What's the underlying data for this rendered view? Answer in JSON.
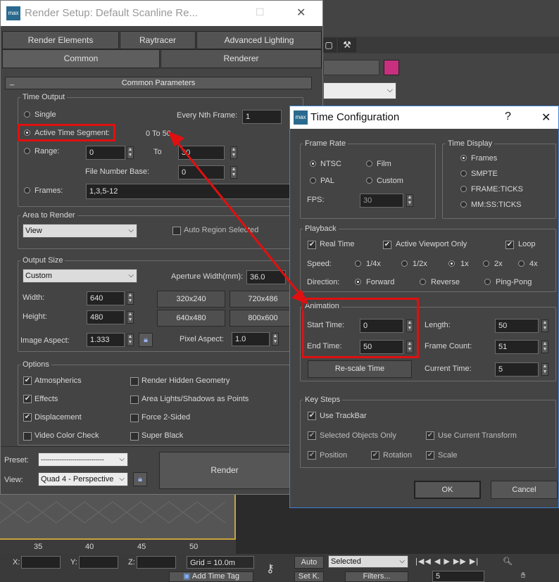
{
  "render_setup": {
    "title": "Render Setup: Default Scanline Re...",
    "tabs_row1": [
      "Render Elements",
      "Raytracer",
      "Advanced Lighting"
    ],
    "tabs_row2": [
      "Common",
      "Renderer"
    ],
    "rollout_title": "Common Parameters",
    "rollout_toggle": "_",
    "time_output": {
      "label": "Time Output",
      "single": "Single",
      "every_nth_label": "Every Nth Frame:",
      "every_nth_value": "1",
      "active_segment": "Active Time Segment:",
      "active_segment_value": "0 To 50",
      "range": "Range:",
      "range_from": "0",
      "range_to_label": "To",
      "range_to": "30",
      "file_number_base_label": "File Number Base:",
      "file_number_base": "0",
      "frames": "Frames:",
      "frames_value": "1,3,5-12"
    },
    "area_to_render": {
      "label": "Area to Render",
      "selected": "View",
      "auto_region": "Auto Region Selected"
    },
    "output_size": {
      "label": "Output Size",
      "preset": "Custom",
      "aperture_label": "Aperture Width(mm):",
      "aperture_value": "36.0",
      "width_label": "Width:",
      "width": "640",
      "height_label": "Height:",
      "height": "480",
      "presets": [
        "320x240",
        "720x486",
        "640x480",
        "800x600"
      ],
      "image_aspect_label": "Image Aspect:",
      "image_aspect": "1.333",
      "pixel_aspect_label": "Pixel Aspect:",
      "pixel_aspect": "1.0"
    },
    "options": {
      "label": "Options",
      "items": [
        {
          "label": "Atmospherics",
          "checked": true
        },
        {
          "label": "Render Hidden Geometry",
          "checked": false
        },
        {
          "label": "Effects",
          "checked": true
        },
        {
          "label": "Area Lights/Shadows as Points",
          "checked": false
        },
        {
          "label": "Displacement",
          "checked": true
        },
        {
          "label": "Force 2-Sided",
          "checked": false
        },
        {
          "label": "Video Color Check",
          "checked": false
        },
        {
          "label": "Super Black",
          "checked": false
        }
      ]
    },
    "preset_label": "Preset:",
    "preset_value": "------------------------------",
    "view_label": "View:",
    "view_value": "Quad 4 - Perspective",
    "render_button": "Render"
  },
  "time_configuration": {
    "title": "Time Configuration",
    "help": "?",
    "close": "✕",
    "frame_rate": {
      "label": "Frame Rate",
      "options": [
        "NTSC",
        "Film",
        "PAL",
        "Custom"
      ],
      "selected": "NTSC",
      "fps_label": "FPS:",
      "fps": "30"
    },
    "time_display": {
      "label": "Time Display",
      "options": [
        "Frames",
        "SMPTE",
        "FRAME:TICKS",
        "MM:SS:TICKS"
      ],
      "selected": "Frames"
    },
    "playback": {
      "label": "Playback",
      "real_time": "Real Time",
      "active_viewport_only": "Active Viewport Only",
      "loop": "Loop",
      "speed_label": "Speed:",
      "speeds": [
        "1/4x",
        "1/2x",
        "1x",
        "2x",
        "4x"
      ],
      "speed_selected": "1x",
      "direction_label": "Direction:",
      "directions": [
        "Forward",
        "Reverse",
        "Ping-Pong"
      ],
      "direction_selected": "Forward"
    },
    "animation": {
      "label": "Animation",
      "start_label": "Start Time:",
      "start": "0",
      "end_label": "End Time:",
      "end": "50",
      "length_label": "Length:",
      "length": "50",
      "frame_count_label": "Frame Count:",
      "frame_count": "51",
      "rescale": "Re-scale Time",
      "current_label": "Current Time:",
      "current": "5"
    },
    "key_steps": {
      "label": "Key Steps",
      "use_trackbar": "Use TrackBar",
      "selected_only": "Selected Objects Only",
      "use_current_transform": "Use Current Transform",
      "position": "Position",
      "rotation": "Rotation",
      "scale": "Scale"
    },
    "ok": "OK",
    "cancel": "Cancel"
  },
  "timeline": {
    "ticks": [
      "35",
      "40",
      "45",
      "50"
    ]
  },
  "status_bar": {
    "x_label": "X:",
    "y_label": "Y:",
    "z_label": "Z:",
    "grid": "Grid = 10.0m",
    "add_time_tag": "Add Time Tag",
    "auto": "Auto",
    "set_key": "Set K.",
    "selected": "Selected",
    "filters": "Filters...",
    "frame": "5"
  },
  "colors": {
    "highlight_red": "#e01010",
    "swatch_magenta": "#c8307f",
    "dialog_border": "#3c7fd6"
  }
}
